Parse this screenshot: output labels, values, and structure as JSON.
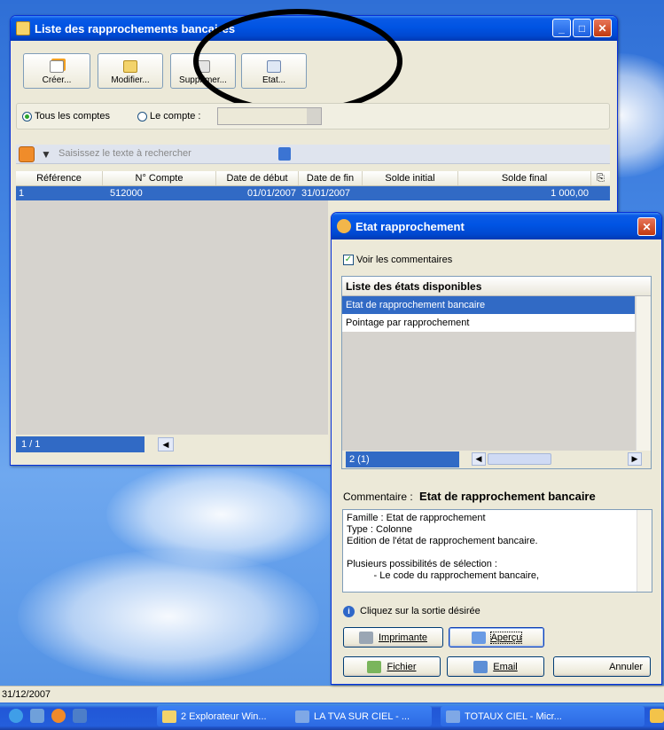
{
  "main_window": {
    "title": "Liste des rapprochements bancaires",
    "toolbar": {
      "create": "Créer...",
      "modify": "Modifier...",
      "delete": "Supprimer...",
      "state": "Etat..."
    },
    "filter": {
      "all_accounts": "Tous les comptes",
      "account": "Le compte :"
    },
    "search_placeholder": "Saisissez le texte à rechercher",
    "columns": [
      "Référence",
      "N° Compte",
      "Date de début",
      "Date de fin",
      "Solde initial",
      "Solde final"
    ],
    "rows": [
      {
        "reference": "1",
        "account": "512000",
        "start": "01/01/2007",
        "end": "31/01/2007",
        "initial": "",
        "final": "1 000,00"
      }
    ],
    "pager": "1 / 1"
  },
  "dialog": {
    "title": "Etat rapprochement",
    "show_comments": "Voir les commentaires",
    "list_header": "Liste des états disponibles",
    "items": [
      "Etat de rapprochement bancaire",
      "Pointage par rapprochement"
    ],
    "selected_index": 0,
    "count": "2 (1)",
    "comment_label": "Commentaire :",
    "comment_title": "Etat de rapprochement bancaire",
    "comment_lines": [
      "Famille : Etat de rapprochement",
      "Type : Colonne",
      "Edition de l'état de rapprochement bancaire.",
      "",
      "Plusieurs possibilités de sélection :",
      "          - Le code du rapprochement bancaire,"
    ],
    "hint": "Cliquez sur la sortie désirée",
    "buttons": {
      "print": "Imprimante",
      "preview": "Aperçu",
      "file": "Fichier",
      "email": "Email",
      "cancel": "Annuler"
    }
  },
  "status_date": "31/12/2007",
  "taskbar": {
    "items": [
      "2 Explorateur Win...",
      "LA TVA SUR CIEL - ...",
      "TOTAUX CIEL - Micr..."
    ]
  },
  "colors": {
    "xp_blue": "#0054e3",
    "selection": "#316ac5",
    "window_bg": "#ece9d8"
  }
}
